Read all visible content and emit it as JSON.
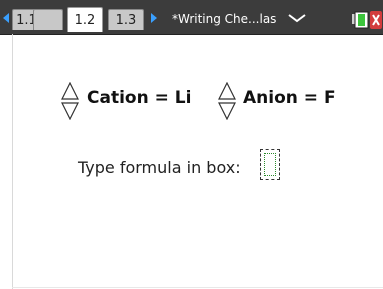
{
  "tabs": [
    {
      "label": "1.1",
      "active": false
    },
    {
      "label": "1.2",
      "active": true
    },
    {
      "label": "1.3",
      "active": false
    }
  ],
  "document_title": "*Writing Che...las",
  "icons": {
    "prev_page": "left-arrow-icon",
    "next_page": "right-arrow-icon",
    "menu": "chevron-down-icon",
    "battery": "battery-icon"
  },
  "cation": {
    "label": "Cation = Li"
  },
  "anion": {
    "label": "Anion = F"
  },
  "prompt": {
    "text": "Type formula in box:"
  },
  "answer": {
    "value": ""
  },
  "colors": {
    "topbar": "#3c3c3c",
    "nav_arrow": "#3aa0ff",
    "battery_green": "#3cc43c",
    "battery_red": "#d23c3c"
  }
}
